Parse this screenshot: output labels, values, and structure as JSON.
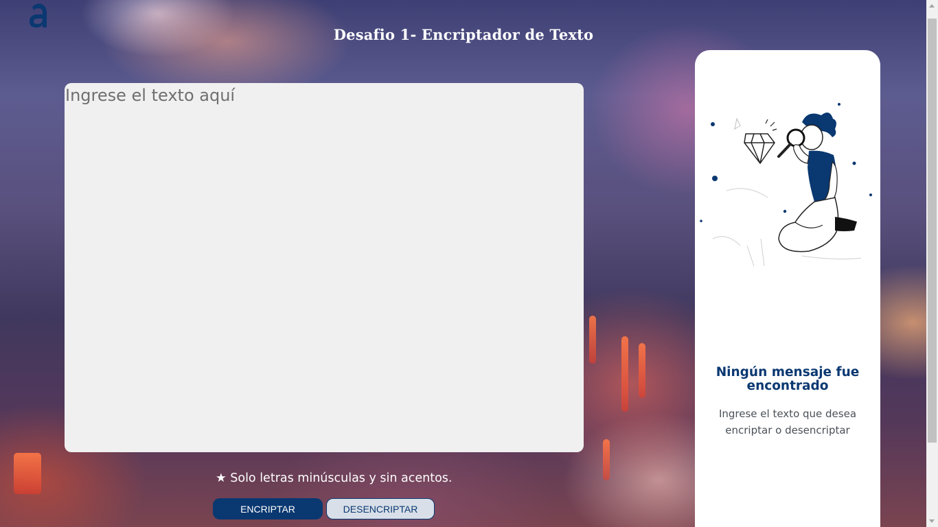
{
  "page": {
    "title": "Desafio 1- Encriptador de Texto",
    "logo_icon": "alura-logo-icon"
  },
  "input": {
    "placeholder": "Ingrese el texto aquí",
    "value": ""
  },
  "hint": {
    "icon": "star-icon",
    "text": "★ Solo letras minúsculas y sin acentos."
  },
  "actions": {
    "encrypt_label": "ENCRIPTAR",
    "decrypt_label": "DESENCRIPTAR"
  },
  "output_panel": {
    "illustration": "person-with-magnifying-glass-illustration",
    "heading": "Ningún mensaje fue encontrado",
    "description": "Ingrese el texto que desea encriptar o desencriptar"
  },
  "colors": {
    "primary": "#0a3871",
    "input_background": "#f0f0f0",
    "secondary_button": "#d8dfe8",
    "panel_background": "#ffffff"
  }
}
